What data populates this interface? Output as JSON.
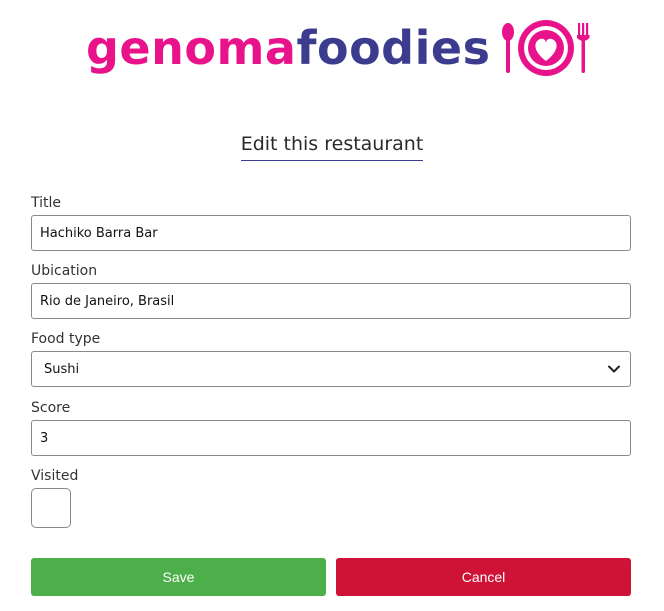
{
  "brand": {
    "name_part1": "genoma",
    "name_part2": "foodies",
    "primary_color": "#e8138b",
    "secondary_color": "#3c3c8f",
    "logo_icon": "plate-heart-fork-spoon-icon"
  },
  "page": {
    "heading": "Edit this restaurant"
  },
  "form": {
    "title": {
      "label": "Title",
      "value": "Hachiko Barra Bar"
    },
    "ubication": {
      "label": "Ubication",
      "value": "Rio de Janeiro, Brasil"
    },
    "food_type": {
      "label": "Food type",
      "selected": "Sushi"
    },
    "score": {
      "label": "Score",
      "value": "3"
    },
    "visited": {
      "label": "Visited",
      "checked": false
    }
  },
  "actions": {
    "save_label": "Save",
    "cancel_label": "Cancel",
    "save_color": "#4caf4a",
    "cancel_color": "#cf1337"
  }
}
